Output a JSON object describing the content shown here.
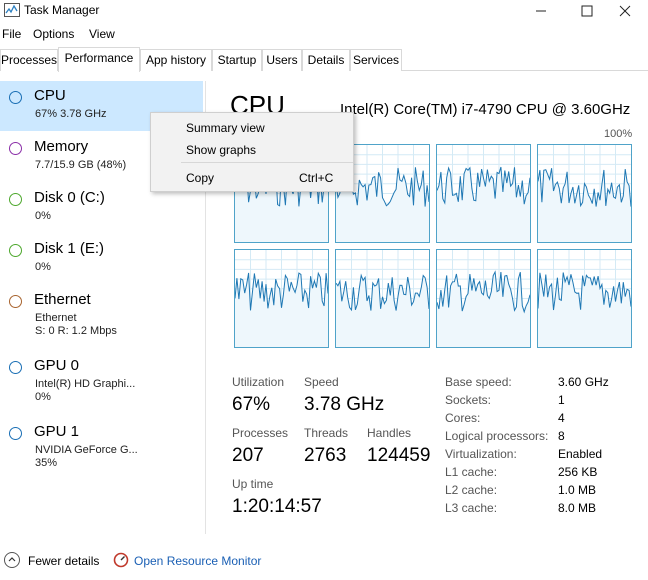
{
  "window": {
    "title": "Task Manager"
  },
  "menu": [
    "File",
    "Options",
    "View"
  ],
  "tabs": [
    {
      "label": "Processes",
      "active": false
    },
    {
      "label": "Performance",
      "active": true
    },
    {
      "label": "App history",
      "active": false
    },
    {
      "label": "Startup",
      "active": false
    },
    {
      "label": "Users",
      "active": false
    },
    {
      "label": "Details",
      "active": false
    },
    {
      "label": "Services",
      "active": false
    }
  ],
  "resources": [
    {
      "name": "CPU",
      "line1": "67%  3.78 GHz",
      "line2": "",
      "color": "#1a6fb5",
      "selected": true
    },
    {
      "name": "Memory",
      "line1": "7.7/15.9 GB (48%)",
      "line2": "",
      "color": "#8b2fa8",
      "selected": false
    },
    {
      "name": "Disk 0 (C:)",
      "line1": "0%",
      "line2": "",
      "color": "#4ea82e",
      "selected": false
    },
    {
      "name": "Disk 1 (E:)",
      "line1": "0%",
      "line2": "",
      "color": "#4ea82e",
      "selected": false
    },
    {
      "name": "Ethernet",
      "line1": "Ethernet",
      "line2": "S: 0  R: 1.2 Mbps",
      "color": "#a8642f",
      "selected": false
    },
    {
      "name": "GPU 0",
      "line1": "Intel(R) HD Graphi...",
      "line2": "0%",
      "color": "#1a6fb5",
      "selected": false
    },
    {
      "name": "GPU 1",
      "line1": "NVIDIA GeForce G...",
      "line2": "35%",
      "color": "#1a6fb5",
      "selected": false
    }
  ],
  "cpu": {
    "title": "CPU",
    "model": "Intel(R) Core(TM) i7-4790 CPU @ 3.60GHz",
    "graph_label_left": "conds",
    "graph_label_right": "100%"
  },
  "stats": {
    "utilization_label": "Utilization",
    "utilization": "67%",
    "speed_label": "Speed",
    "speed": "3.78 GHz",
    "processes_label": "Processes",
    "processes": "207",
    "threads_label": "Threads",
    "threads": "2763",
    "handles_label": "Handles",
    "handles": "124459",
    "uptime_label": "Up time",
    "uptime": "1:20:14:57"
  },
  "specs": [
    {
      "label": "Base speed:",
      "value": "3.60 GHz"
    },
    {
      "label": "Sockets:",
      "value": "1"
    },
    {
      "label": "Cores:",
      "value": "4"
    },
    {
      "label": "Logical processors:",
      "value": "8"
    },
    {
      "label": "Virtualization:",
      "value": "Enabled"
    },
    {
      "label": "L1 cache:",
      "value": "256 KB"
    },
    {
      "label": "L2 cache:",
      "value": "1.0 MB"
    },
    {
      "label": "L3 cache:",
      "value": "8.0 MB"
    }
  ],
  "context_menu": {
    "summary_view": "Summary view",
    "show_graphs": "Show graphs",
    "copy": "Copy",
    "copy_shortcut": "Ctrl+C"
  },
  "footer": {
    "fewer_details": "Fewer details",
    "open_resource_monitor": "Open Resource Monitor"
  },
  "colors": {
    "selected_bg": "#cce8ff",
    "graph_border": "#4fa3c9",
    "graph_line": "#1f78b4",
    "link": "#1a5fb4"
  }
}
